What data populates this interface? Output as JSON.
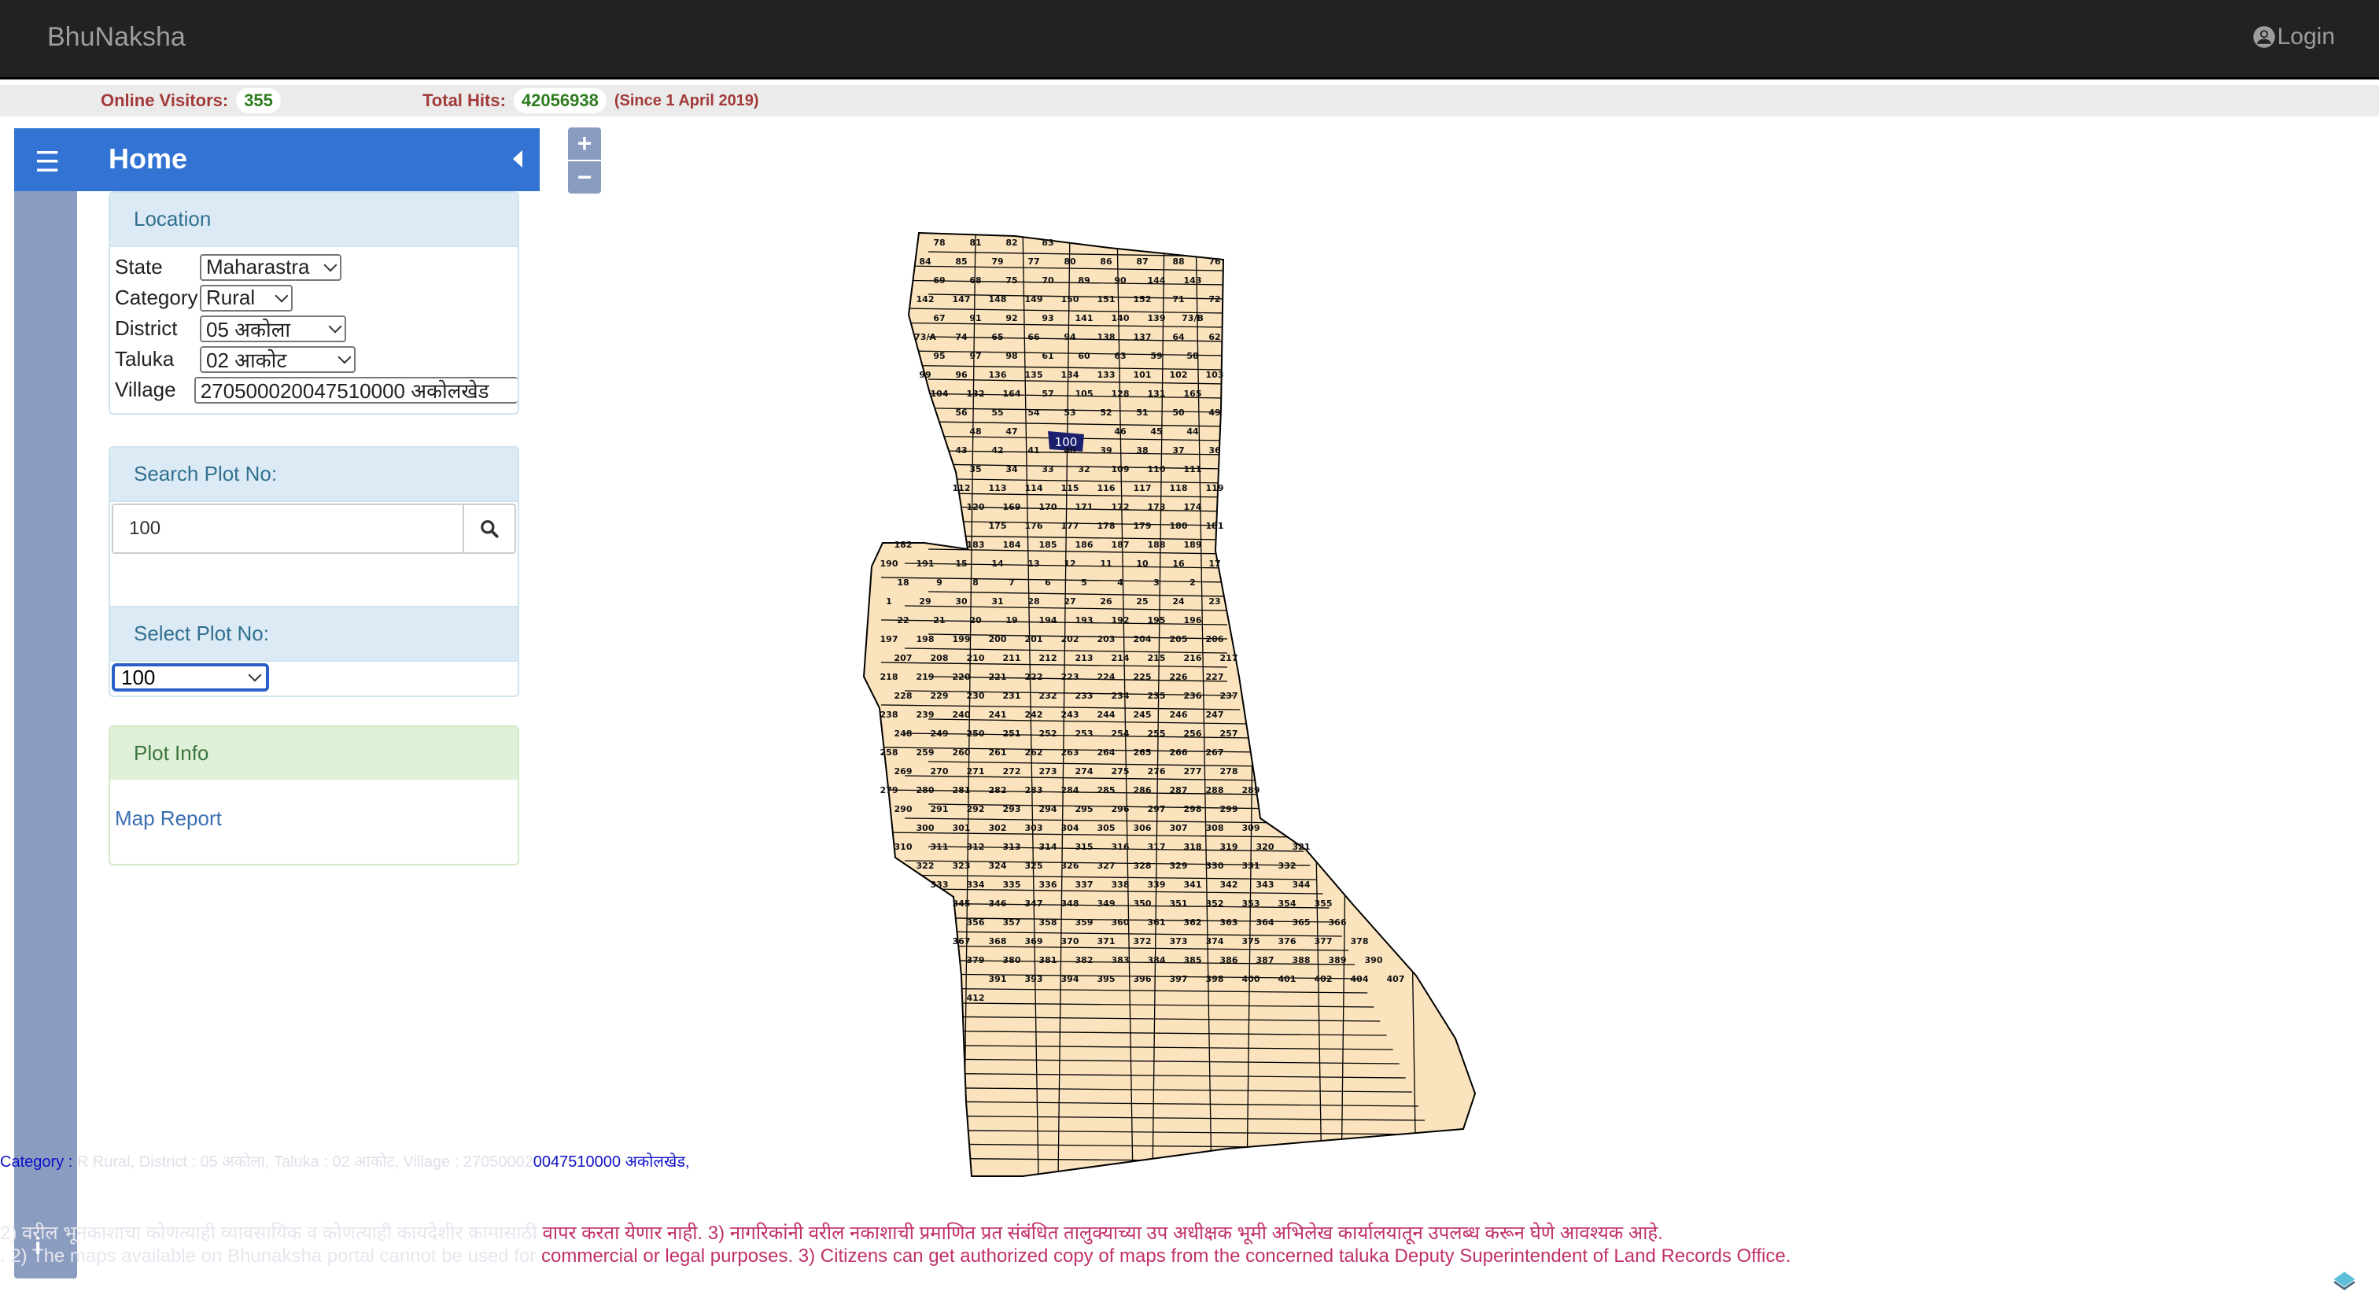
{
  "app": {
    "title": "BhuNaksha",
    "login_label": "Login"
  },
  "stats": {
    "online_label": "Online Visitors:",
    "online_value": "355",
    "hits_label": "Total Hits:",
    "hits_value": "42056938",
    "hits_since": "(Since 1 April 2019)"
  },
  "sidebar": {
    "title": "Home",
    "location": {
      "heading": "Location",
      "fields": [
        {
          "label": "State",
          "value": "Maharastra"
        },
        {
          "label": "Category",
          "value": "Rural"
        },
        {
          "label": "District",
          "value": "05 अकोला"
        },
        {
          "label": "Taluka",
          "value": "02 आकोट"
        },
        {
          "label": "Village",
          "value": "270500020047510000 अकोलखेड"
        }
      ]
    },
    "search": {
      "heading": "Search Plot No:",
      "value": "100"
    },
    "select_plot": {
      "heading": "Select Plot No:",
      "value": "100"
    },
    "plot_info": {
      "heading": "Plot Info",
      "link": "Map Report"
    }
  },
  "map": {
    "zoom_in": "+",
    "zoom_out": "−",
    "selected_plot": "100",
    "colors": {
      "parcel_fill": "#fae3bd",
      "selected_fill": "#1c1f6e",
      "border": "#000000"
    },
    "plot_labels": [
      "78",
      "81",
      "82",
      "83",
      "84",
      "85",
      "79",
      "77",
      "80",
      "86",
      "87",
      "88",
      "76",
      "69",
      "68",
      "75",
      "70",
      "89",
      "90",
      "144",
      "143",
      "142",
      "147",
      "148",
      "149",
      "150",
      "151",
      "152",
      "71",
      "72",
      "67",
      "91",
      "92",
      "93",
      "141",
      "140",
      "139",
      "73/B",
      "73/A",
      "74",
      "65",
      "66",
      "94",
      "138",
      "137",
      "64",
      "62",
      "95",
      "97",
      "98",
      "61",
      "60",
      "63",
      "59",
      "58",
      "99",
      "96",
      "136",
      "135",
      "134",
      "133",
      "101",
      "102",
      "103",
      "104",
      "132",
      "164",
      "57",
      "105",
      "128",
      "131",
      "165",
      "56",
      "55",
      "54",
      "53",
      "52",
      "51",
      "50",
      "49",
      "48",
      "47",
      "46",
      "45",
      "44",
      "43",
      "42",
      "41",
      "40",
      "39",
      "38",
      "37",
      "36",
      "35",
      "34",
      "33",
      "32",
      "109",
      "110",
      "111",
      "112",
      "113",
      "114",
      "115",
      "116",
      "117",
      "118",
      "119",
      "120",
      "169",
      "170",
      "171",
      "172",
      "173",
      "174",
      "175",
      "176",
      "177",
      "178",
      "179",
      "180",
      "181",
      "182",
      "183",
      "184",
      "185",
      "186",
      "187",
      "188",
      "189",
      "190",
      "191",
      "15",
      "14",
      "13",
      "12",
      "11",
      "10",
      "16",
      "17",
      "18",
      "9",
      "8",
      "7",
      "6",
      "5",
      "4",
      "3",
      "2",
      "1",
      "29",
      "30",
      "31",
      "28",
      "27",
      "26",
      "25",
      "24",
      "23",
      "22",
      "21",
      "20",
      "19",
      "194",
      "193",
      "192",
      "195",
      "196",
      "197",
      "198",
      "199",
      "200",
      "201",
      "202",
      "203",
      "204",
      "205",
      "206",
      "207",
      "208",
      "210",
      "211",
      "212",
      "213",
      "214",
      "215",
      "216",
      "217",
      "218",
      "219",
      "220",
      "221",
      "222",
      "223",
      "224",
      "225",
      "226",
      "227",
      "228",
      "229",
      "230",
      "231",
      "232",
      "233",
      "234",
      "235",
      "236",
      "237",
      "238",
      "239",
      "240",
      "241",
      "242",
      "243",
      "244",
      "245",
      "246",
      "247",
      "248",
      "249",
      "250",
      "251",
      "252",
      "253",
      "254",
      "255",
      "256",
      "257",
      "258",
      "259",
      "260",
      "261",
      "262",
      "263",
      "264",
      "265",
      "266",
      "267",
      "269",
      "270",
      "271",
      "272",
      "273",
      "274",
      "275",
      "276",
      "277",
      "278",
      "279",
      "280",
      "281",
      "282",
      "283",
      "284",
      "285",
      "286",
      "287",
      "288",
      "289",
      "290",
      "291",
      "292",
      "293",
      "294",
      "295",
      "296",
      "297",
      "298",
      "299",
      "300",
      "301",
      "302",
      "303",
      "304",
      "305",
      "306",
      "307",
      "308",
      "309",
      "310",
      "311",
      "312",
      "313",
      "314",
      "315",
      "316",
      "317",
      "318",
      "319",
      "320",
      "321",
      "322",
      "323",
      "324",
      "325",
      "326",
      "327",
      "328",
      "329",
      "330",
      "331",
      "332",
      "333",
      "334",
      "335",
      "336",
      "337",
      "338",
      "339",
      "341",
      "342",
      "343",
      "344",
      "345",
      "346",
      "347",
      "348",
      "349",
      "350",
      "351",
      "352",
      "353",
      "354",
      "355",
      "356",
      "357",
      "358",
      "359",
      "360",
      "361",
      "362",
      "363",
      "364",
      "365",
      "366",
      "367",
      "368",
      "369",
      "370",
      "371",
      "372",
      "373",
      "374",
      "375",
      "376",
      "377",
      "378",
      "379",
      "380",
      "381",
      "382",
      "383",
      "384",
      "385",
      "386",
      "387",
      "388",
      "389",
      "390",
      "391",
      "393",
      "394",
      "395",
      "396",
      "397",
      "398",
      "400",
      "401",
      "402",
      "404",
      "407",
      "412"
    ]
  },
  "footer": {
    "info_prefix": "Category :",
    "info_faded": " R Rural, District : 05 अकोला, Taluka : 02 आकोट, Village : 27050002",
    "info_visible": "0047510000 अकोलखेड,",
    "disclaimer_mr_faded": "2) वरील भूनकाशाचा कोणत्याही व्यावसायिक व कोणत्याही कायदेशीर कामासाठी ",
    "disclaimer_mr": "वापर करता येणार नाही. 3) नागरिकांनी वरील नकाशाची प्रमाणित प्रत संबंधित तालुक्याच्या उप अधीक्षक भूमी अभिलेख कार्यालयातून उपलब्ध करून घेणे आवश्यक आहे.",
    "disclaimer_en_faded": ". 2) The maps available on Bhunaksha portal cannot be used for ",
    "disclaimer_en": "commercial or legal purposes. 3) Citizens can get authorized copy of maps from the concerned taluka Deputy Superintendent of Land Records Office."
  }
}
